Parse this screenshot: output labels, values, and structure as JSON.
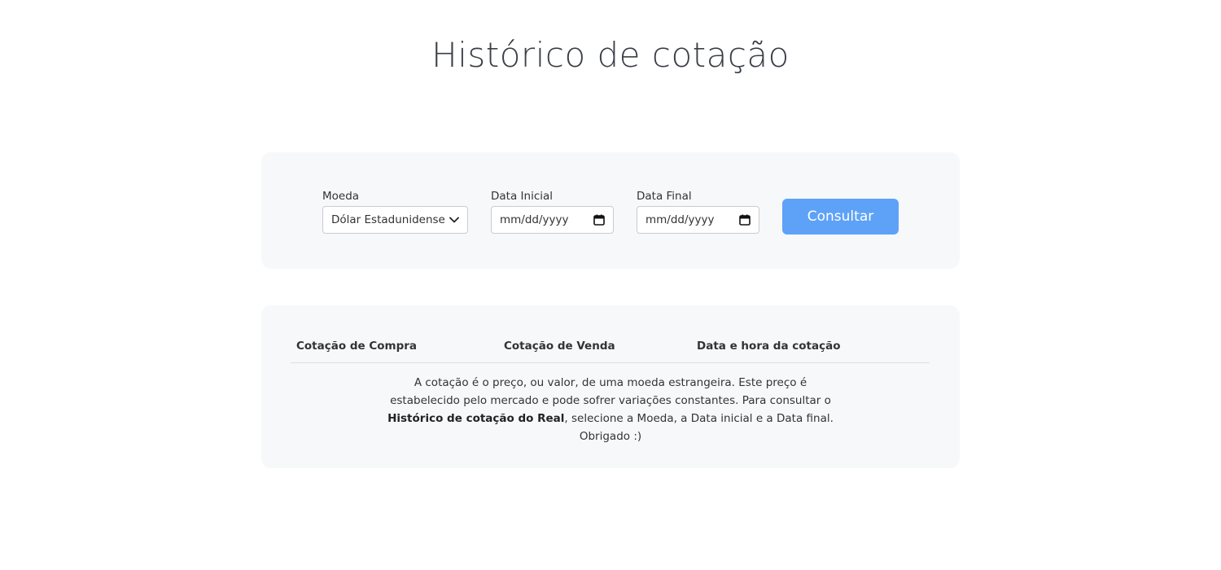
{
  "page": {
    "title": "Histórico de cotação"
  },
  "filters": {
    "moeda_label": "Moeda",
    "moeda_value": "Dólar Estadunidense",
    "data_inicial_label": "Data Inicial",
    "data_inicial_placeholder": "mm/dd/yyyy",
    "data_final_label": "Data Final",
    "data_final_placeholder": "mm/dd/yyyy",
    "submit_label": "Consultar"
  },
  "table": {
    "columns": [
      "Cotação de Compra",
      "Cotação de Venda",
      "Data e hora da cotação"
    ]
  },
  "info": {
    "text_before": "A cotação é o preço, ou valor, de uma moeda estrangeira. Este preço é estabelecido pelo mercado e pode sofrer variações constantes. Para consultar o ",
    "text_bold": "Histórico de cotação do Real",
    "text_after": ", selecione a Moeda, a Data inicial e a Data final. Obrigado :)"
  },
  "colors": {
    "accent": "#5ea2f8",
    "card_background": "#f7f8fa",
    "title": "#3a3f47"
  },
  "icons": {
    "select_caret": "chevron-down-icon",
    "date_picker": "calendar-icon"
  }
}
